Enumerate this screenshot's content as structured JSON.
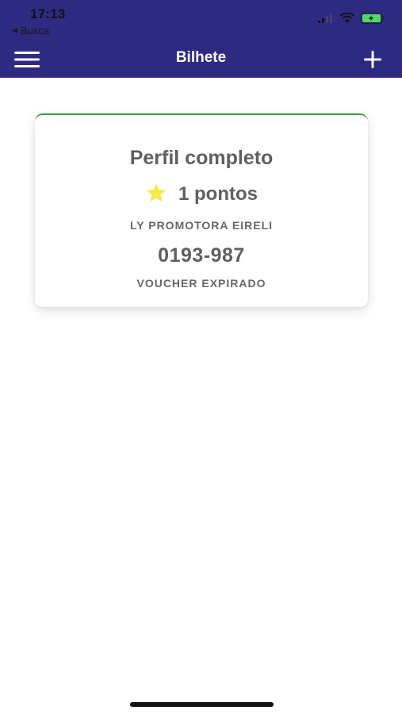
{
  "status_bar": {
    "time": "17:13",
    "back_app_label": "Busca",
    "icons": [
      "cellular-signal-icon",
      "wifi-icon",
      "battery-charging-icon"
    ],
    "battery_color": "#4cd964"
  },
  "nav": {
    "title": "Bilhete",
    "left_icon": "hamburger-menu-icon",
    "right_icon": "plus-icon",
    "background_color": "#2e2a82"
  },
  "voucher_card": {
    "title": "Perfil completo",
    "points": "1 pontos",
    "star_icon": "star-icon",
    "star_color": "#f7e84a",
    "company": "LY PROMOTORA EIRELI",
    "code": "0193-987",
    "status": "VOUCHER EXPIRADO",
    "accent_color": "#3f9a3f"
  }
}
